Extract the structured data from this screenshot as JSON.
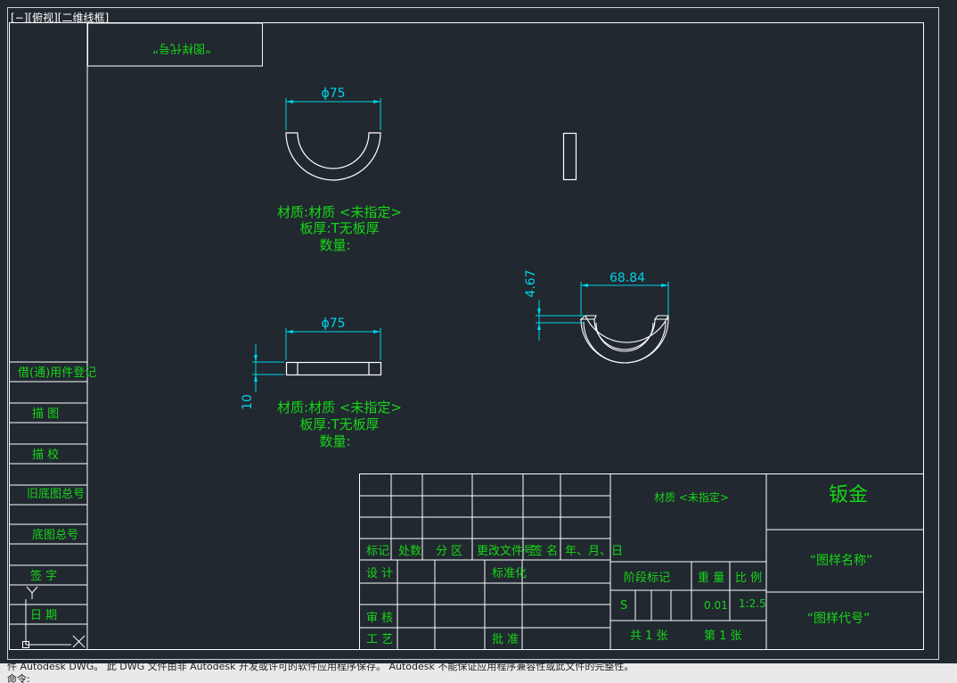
{
  "viewport": {
    "label": "[−][俯视][二维线框]"
  },
  "drawing": {
    "top_left_box_text": "“图样代号”",
    "dim_diameter_1": "ϕ75",
    "dim_diameter_2": "ϕ75",
    "dim_thickness": "10",
    "dim_width": "68.84",
    "dim_height": "4.67",
    "material_note_1": [
      "材质:材质 <未指定>",
      "板厚:T无板厚",
      "数量:"
    ],
    "material_note_2": [
      "材质:材质 <未指定>",
      "板厚:T无板厚",
      "数量:"
    ]
  },
  "left_column": {
    "cells": [
      "借(通)用件登记",
      "描  图",
      "描  校",
      "旧底图总号",
      "底图总号",
      "签  字",
      "日  期"
    ]
  },
  "title_block": {
    "header_row": [
      "标记",
      "处数",
      "分 区",
      "更改文件号",
      "签 名",
      "年、月、日"
    ],
    "row_labels": [
      "设 计",
      "审 核",
      "工 艺"
    ],
    "standardize": "标准化",
    "approve": "批 准",
    "material": "材质 <未指定>",
    "type_name": "钣金",
    "drawing_name": "“图样名称”",
    "drawing_code": "“图样代号”",
    "stage_mark": "阶段标记",
    "weight_label": "重 量",
    "scale_label": "比 例",
    "stage_value": "S",
    "weight_value": "0.01",
    "scale_value": "1:2.5",
    "total_sheets": "共 1 张",
    "sheet_no": "第 1 张"
  },
  "ucs": {
    "y_label": "Y",
    "x_label": "X"
  },
  "command": {
    "history": "件 Autodesk DWG。 此 DWG 文件由非 Autodesk 开发或许可的软件应用程序保存。 Autodesk 不能保证应用程序兼容性或此文件的完整性。",
    "prompt": "命令:",
    "input_value": ""
  },
  "colors": {
    "frame": "#ffffff",
    "dimension": "#00d3e6",
    "text": "#16d616",
    "background": "#212830"
  }
}
